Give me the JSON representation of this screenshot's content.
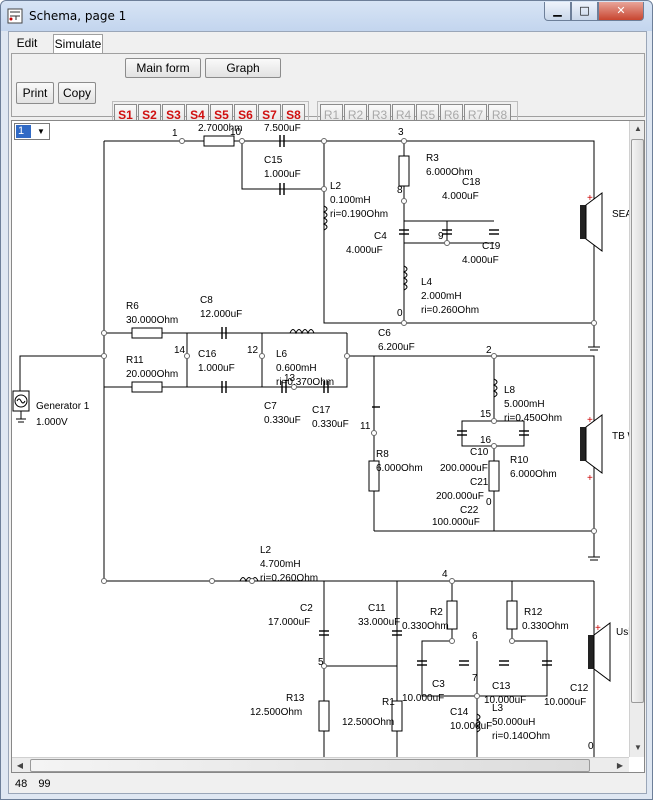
{
  "window": {
    "title": "Schema, page 1",
    "min_glyph": "▁",
    "max_glyph": "□",
    "close_glyph": "✕"
  },
  "menu": {
    "tabs": [
      "Edit",
      "Simulate"
    ]
  },
  "toolbar": {
    "main_form": "Main form",
    "graph": "Graph",
    "print": "Print",
    "copy": "Copy",
    "s_buttons": [
      "S1",
      "S2",
      "S3",
      "S4",
      "S5",
      "S6",
      "S7",
      "S8"
    ],
    "r_buttons": [
      "R1",
      "R2",
      "R3",
      "R4",
      "R5",
      "R6",
      "R7",
      "R8"
    ]
  },
  "page_selector": {
    "value": "1"
  },
  "status": {
    "x": "48",
    "y": "99"
  },
  "schematic": {
    "labels": [
      {
        "t": "1"
      },
      {
        "t": "2.7000hm"
      },
      {
        "t": "10"
      },
      {
        "t": "7.500uF"
      },
      {
        "t": "3"
      },
      {
        "t": "C15"
      },
      {
        "t": "1.000uF"
      },
      {
        "t": "R3"
      },
      {
        "t": "6.000Ohm"
      },
      {
        "t": "L2"
      },
      {
        "t": "0.100mH"
      },
      {
        "t": "ri=0.190Ohm"
      },
      {
        "t": "8"
      },
      {
        "t": "C18"
      },
      {
        "t": "4.000uF"
      },
      {
        "t": "C4"
      },
      {
        "t": "4.000uF"
      },
      {
        "t": "9"
      },
      {
        "t": "C19"
      },
      {
        "t": "4.000uF"
      },
      {
        "t": "L4"
      },
      {
        "t": "2.000mH"
      },
      {
        "t": "ri=0.260Ohm"
      },
      {
        "t": "0"
      },
      {
        "t": "SEAS"
      },
      {
        "t": "R6"
      },
      {
        "t": "30.000Ohm"
      },
      {
        "t": "C8"
      },
      {
        "t": "12.000uF"
      },
      {
        "t": "C6"
      },
      {
        "t": "6.200uF"
      },
      {
        "t": "14"
      },
      {
        "t": "C16"
      },
      {
        "t": "1.000uF"
      },
      {
        "t": "12"
      },
      {
        "t": "L6"
      },
      {
        "t": "0.600mH"
      },
      {
        "t": "ri=0.370Ohm"
      },
      {
        "t": "13"
      },
      {
        "t": "2"
      },
      {
        "t": "R11"
      },
      {
        "t": "20.000Ohm"
      },
      {
        "t": "Generator 1"
      },
      {
        "t": "1.000V"
      },
      {
        "t": "C7"
      },
      {
        "t": "0.330uF"
      },
      {
        "t": "C17"
      },
      {
        "t": "0.330uF"
      },
      {
        "t": "L8"
      },
      {
        "t": "5.000mH"
      },
      {
        "t": "ri=0.450Ohm"
      },
      {
        "t": "15"
      },
      {
        "t": "16"
      },
      {
        "t": "C10"
      },
      {
        "t": "11"
      },
      {
        "t": "TB W"
      },
      {
        "t": "R8"
      },
      {
        "t": "6.000Ohm"
      },
      {
        "t": "200.000uF"
      },
      {
        "t": "R10"
      },
      {
        "t": "6.000Ohm"
      },
      {
        "t": "C21"
      },
      {
        "t": "200.000uF"
      },
      {
        "t": "0"
      },
      {
        "t": "C22"
      },
      {
        "t": "100.000uF"
      },
      {
        "t": "L2"
      },
      {
        "t": "4.700mH"
      },
      {
        "t": "ri=0.260Ohm"
      },
      {
        "t": "4"
      },
      {
        "t": "C2"
      },
      {
        "t": "17.000uF"
      },
      {
        "t": "C11"
      },
      {
        "t": "33.000uF"
      },
      {
        "t": "R2"
      },
      {
        "t": "0.330Ohm"
      },
      {
        "t": "R12"
      },
      {
        "t": "0.330Ohm"
      },
      {
        "t": "6"
      },
      {
        "t": "Ush"
      },
      {
        "t": "5"
      },
      {
        "t": "7"
      },
      {
        "t": "C3"
      },
      {
        "t": "10.000uF"
      },
      {
        "t": "C13"
      },
      {
        "t": "10.000uF"
      },
      {
        "t": "C12"
      },
      {
        "t": "10.000uF"
      },
      {
        "t": "R13"
      },
      {
        "t": "12.500Ohm"
      },
      {
        "t": "R1"
      },
      {
        "t": "12.500Ohm"
      },
      {
        "t": "C14"
      },
      {
        "t": "10.000uF"
      },
      {
        "t": "L3"
      },
      {
        "t": "50.000uH"
      },
      {
        "t": "ri=0.140Ohm"
      },
      {
        "t": "0"
      }
    ]
  }
}
